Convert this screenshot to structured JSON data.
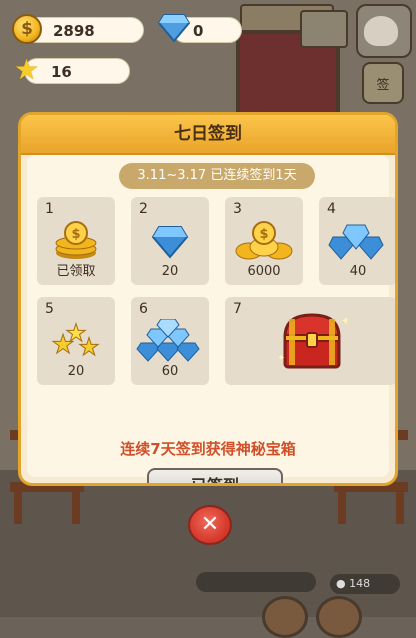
{
  "resources": {
    "coins": "2898",
    "gems": "0",
    "stars": "16"
  },
  "background": {
    "sign_text": "签"
  },
  "dialog": {
    "title": "七日签到",
    "period": "3.11~3.17 已连续签到1天",
    "days": [
      {
        "num": "1",
        "label": "已领取",
        "reward_icon": "coin-stack-icon"
      },
      {
        "num": "2",
        "label": "20",
        "reward_icon": "gem-icon"
      },
      {
        "num": "3",
        "label": "6000",
        "reward_icon": "coin-pile-icon"
      },
      {
        "num": "4",
        "label": "40",
        "reward_icon": "gem-pile-icon"
      },
      {
        "num": "5",
        "label": "20",
        "reward_icon": "star-pile-icon"
      },
      {
        "num": "6",
        "label": "60",
        "reward_icon": "gem-heap-icon"
      },
      {
        "num": "7",
        "label": "",
        "reward_icon": "treasure-chest-icon"
      }
    ],
    "footer": "连续7天签到获得神秘宝箱",
    "button_label": "已签到"
  },
  "bottom": {
    "coin_count": "148"
  },
  "colors": {
    "header": "#f2b43a",
    "panel": "#fdf6e5",
    "card": "#e6dccb",
    "footer_text": "#d0502a",
    "close": "#d73c2e"
  }
}
